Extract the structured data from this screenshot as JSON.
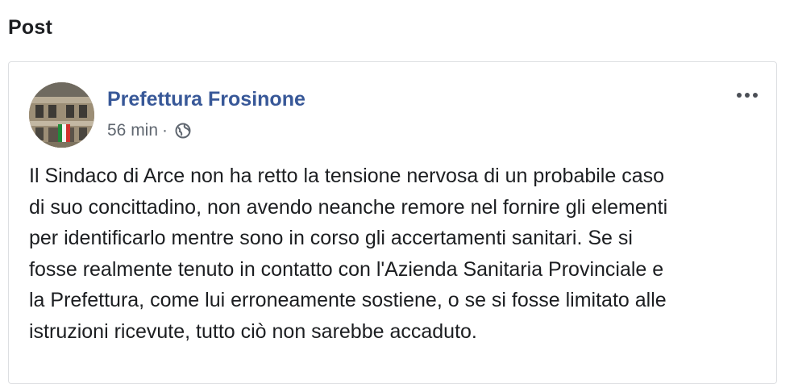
{
  "section": {
    "title": "Post"
  },
  "post": {
    "author": "Prefettura Frosinone",
    "time": "56 min",
    "separator": "·",
    "audience_icon": "globe-icon",
    "menu_icon": "more-horizontal-icon",
    "text_lines": [
      "Il Sindaco di Arce non ha retto la tensione nervosa di un probabile caso",
      "di suo concittadino, non avendo neanche remore nel fornire gli elementi",
      "per identificarlo mentre sono in corso gli accertamenti sanitari. Se si",
      "fosse realmente tenuto in contatto con l'Azienda Sanitaria Provinciale e",
      "la Prefettura, come lui erroneamente sostiene, o se si fosse limitato alle",
      "istruzioni ricevute, tutto ciò non sarebbe accaduto."
    ]
  },
  "colors": {
    "author_link": "#385898",
    "meta_text": "#606770",
    "body_text": "#1c1e21",
    "card_border": "#dddfe2"
  }
}
